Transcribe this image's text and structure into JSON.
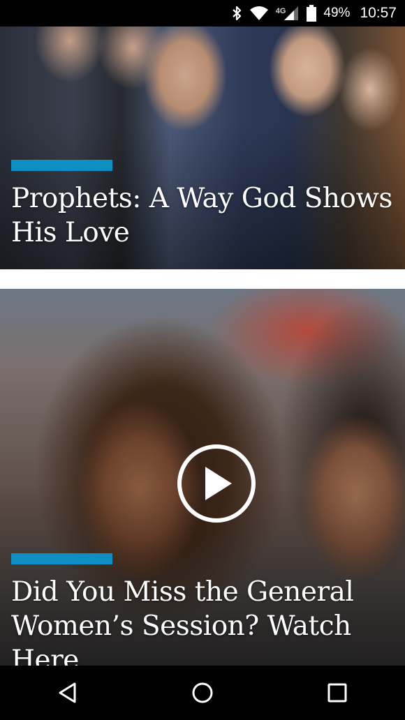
{
  "status_bar": {
    "network": "4G",
    "battery_percent": "49%",
    "time": "10:57",
    "icons": [
      "bluetooth-icon",
      "wifi-icon",
      "cell-signal-icon",
      "battery-icon"
    ]
  },
  "feed": {
    "accent_color": "#0e8ec2",
    "cards": [
      {
        "title": "Prophets: A Way God Shows His Love",
        "has_video": false
      },
      {
        "title": "Did You Miss the General Women’s Session? Watch Here",
        "has_video": true,
        "play_icon": "play-icon"
      }
    ]
  },
  "nav_bar": {
    "buttons": [
      "back-icon",
      "home-icon",
      "recents-icon"
    ]
  }
}
